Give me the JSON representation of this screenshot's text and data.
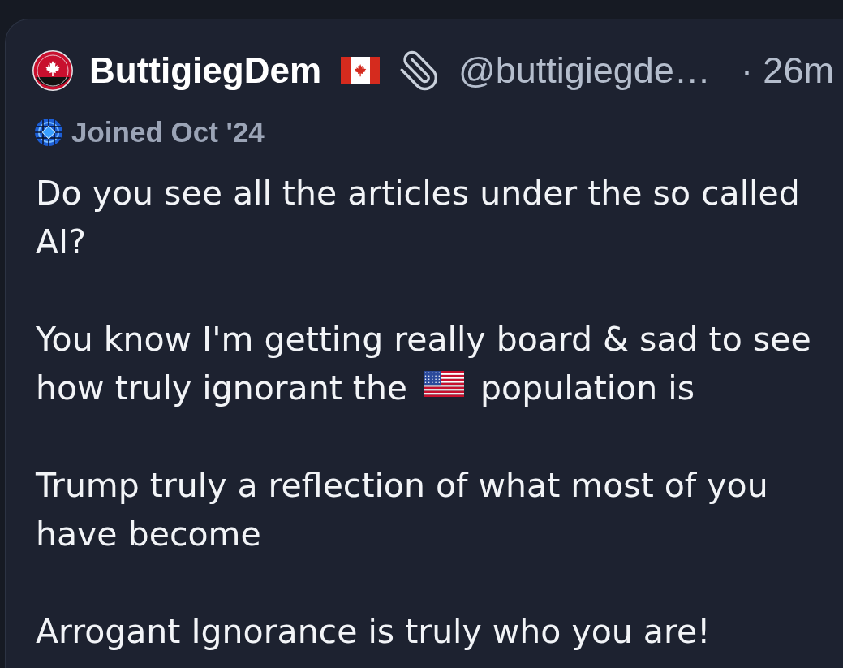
{
  "post": {
    "author": {
      "display_name": "ButtigiegDem",
      "handle": "@buttigiegde…",
      "time": "· 26m",
      "joined": "Joined Oct '24"
    },
    "paragraphs": [
      {
        "segments": [
          {
            "kind": "text",
            "text": "Do you see all the articles under the so called AI?"
          }
        ]
      },
      {
        "segments": [
          {
            "kind": "text",
            "text": "You know I'm getting really board & sad to see"
          },
          {
            "kind": "text",
            "text": "how truly ignorant the"
          },
          {
            "kind": "emoji"
          },
          {
            "kind": "text",
            "text": "population is"
          }
        ]
      },
      {
        "segments": [
          {
            "kind": "text",
            "text": "Trump truly a reflection of what most of you have become"
          }
        ]
      },
      {
        "segments": [
          {
            "kind": "text",
            "text": "Arrogant Ignorance is truly who you are!"
          }
        ]
      }
    ]
  }
}
